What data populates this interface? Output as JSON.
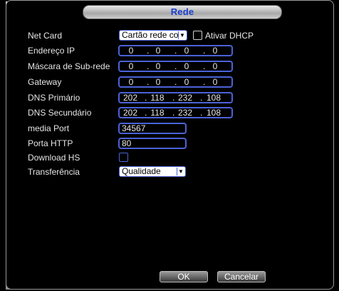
{
  "window": {
    "title": "Rede"
  },
  "net_card": {
    "label": "Net Card",
    "value": "Cartão rede co",
    "dhcp_label": "Ativar DHCP"
  },
  "ip": {
    "label": "Endereço IP",
    "octets": [
      "0",
      "0",
      "0",
      "0"
    ]
  },
  "mask": {
    "label": "Máscara de Sub-rede",
    "octets": [
      "0",
      "0",
      "0",
      "0"
    ]
  },
  "gateway": {
    "label": "Gateway",
    "octets": [
      "0",
      "0",
      "0",
      "0"
    ]
  },
  "dns1": {
    "label": "DNS Primário",
    "octets": [
      "202",
      "118",
      "232",
      "108"
    ]
  },
  "dns2": {
    "label": "DNS Secundário",
    "octets": [
      "202",
      "118",
      "232",
      "108"
    ]
  },
  "media_port": {
    "label": "media Port",
    "value": "34567"
  },
  "http_port": {
    "label": "Porta HTTP",
    "value": "80"
  },
  "download_hs": {
    "label": "Download HS"
  },
  "transfer": {
    "label": "Transferência",
    "value": "Qualidade"
  },
  "buttons": {
    "ok": "OK",
    "cancel": "Cancelar"
  },
  "colors": {
    "accent": "#4a62d8",
    "title": "#1a3fd0",
    "background": "#000000"
  }
}
